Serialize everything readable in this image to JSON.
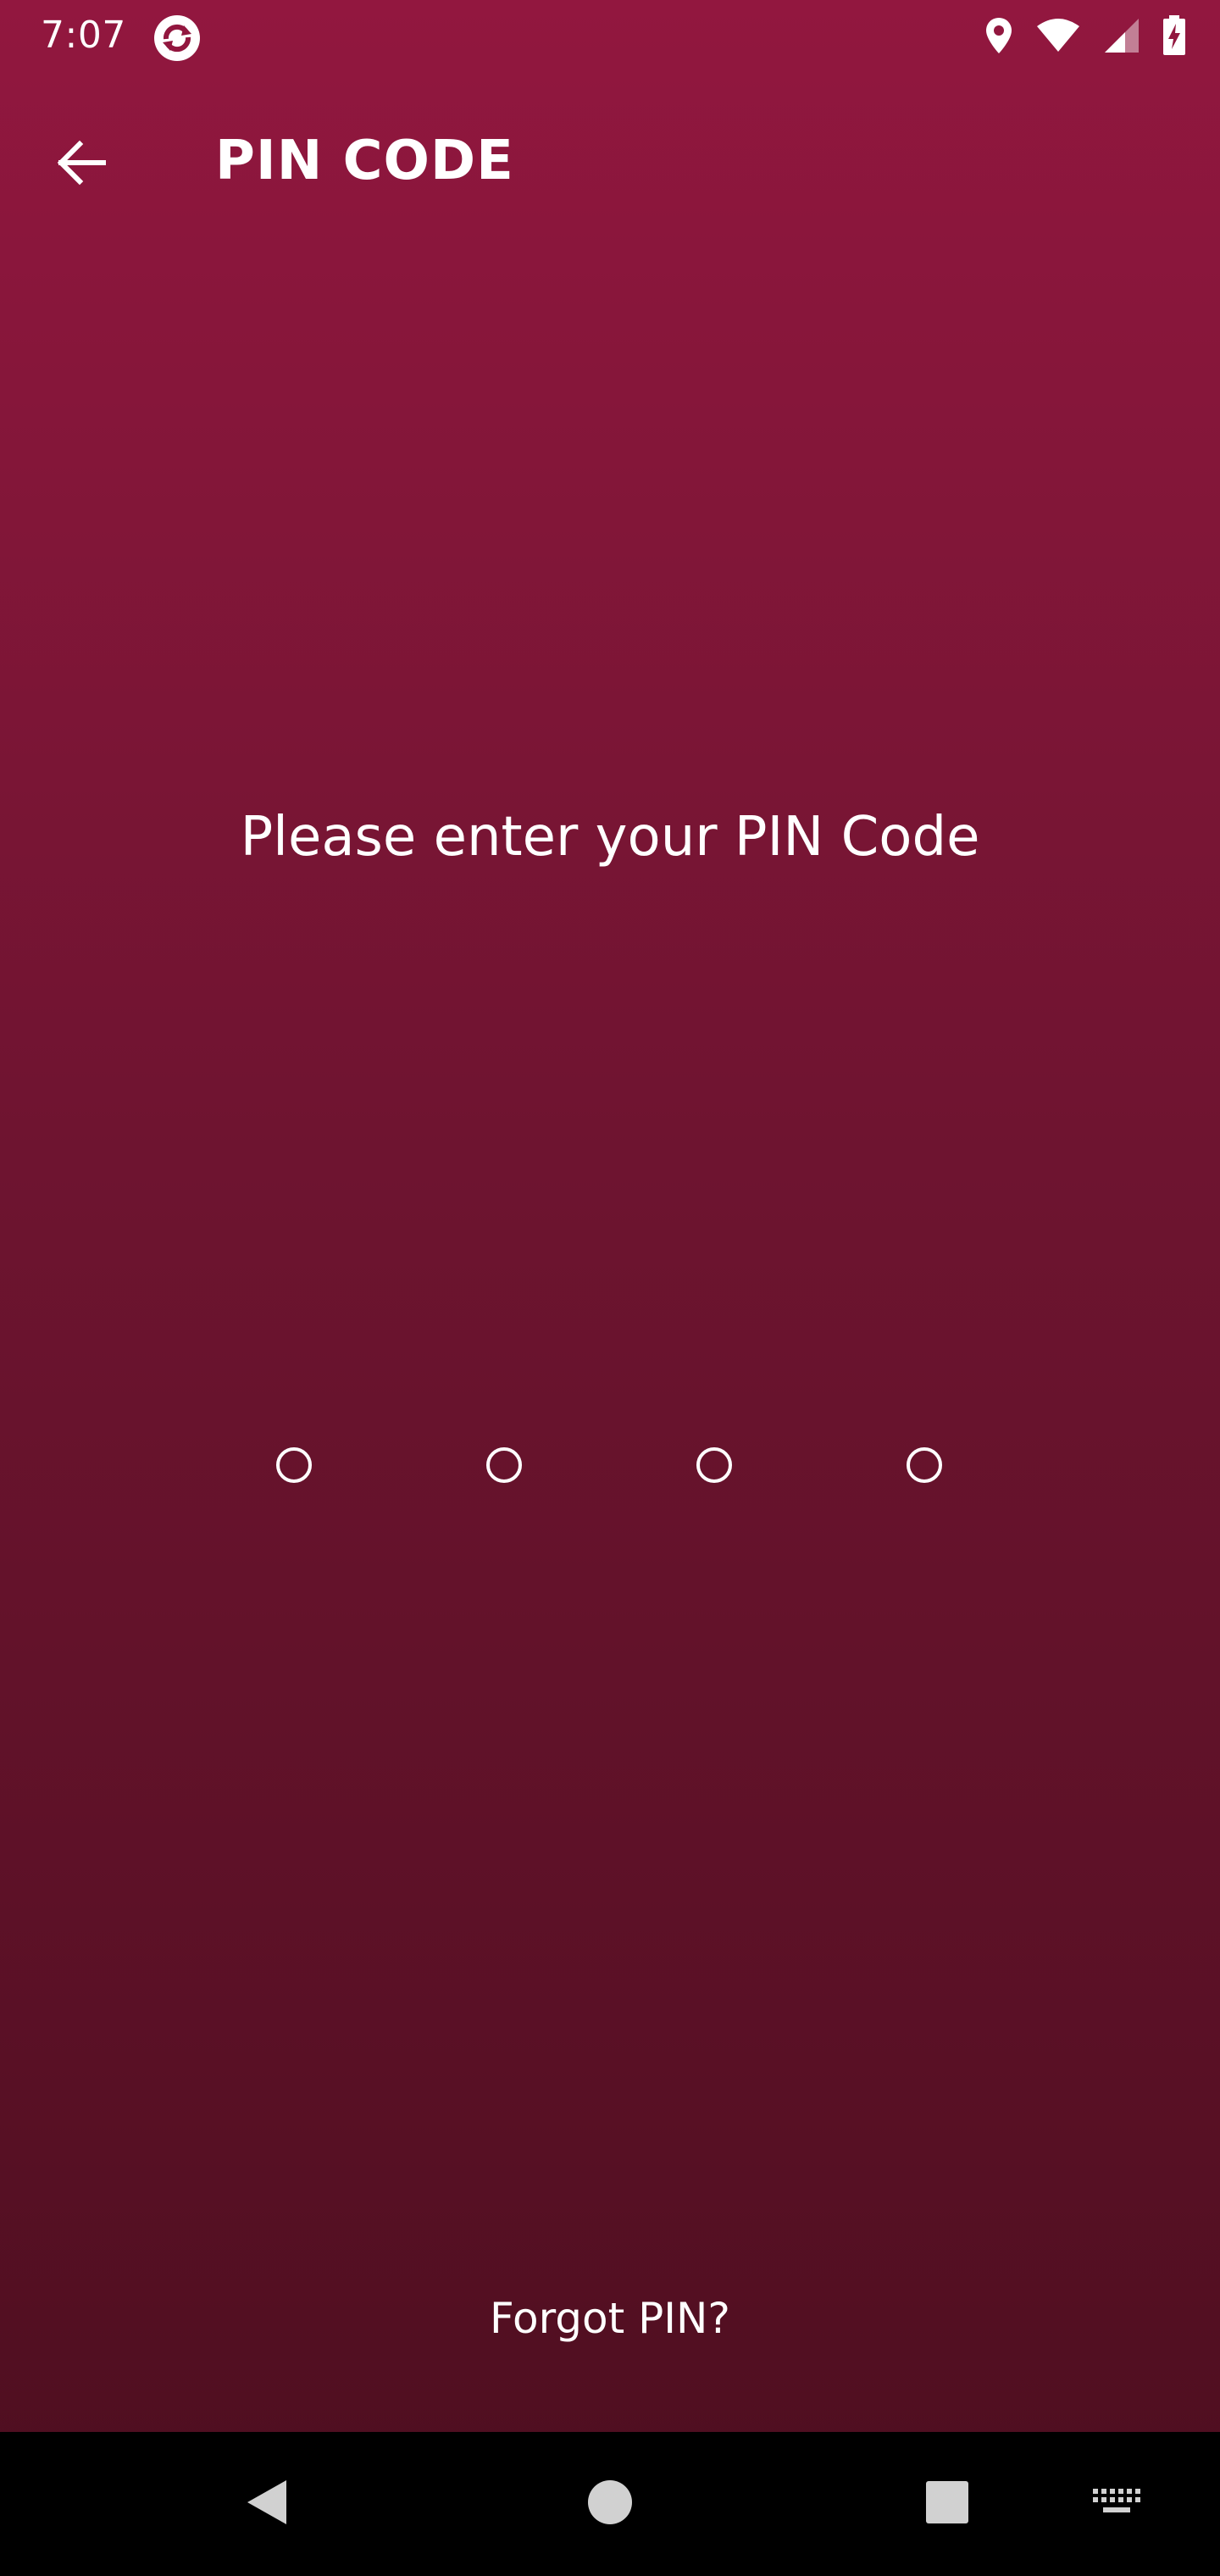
{
  "status_bar": {
    "time": "7:07",
    "icons": [
      "app-sync-icon",
      "location-icon",
      "wifi-icon",
      "signal-icon",
      "battery-charging-icon"
    ]
  },
  "app_bar": {
    "back_icon": "arrow-back-icon",
    "title": "PIN CODE"
  },
  "main": {
    "prompt": "Please enter your PIN Code",
    "pin_length": 4,
    "pin_entered": 0,
    "forgot_label": "Forgot PIN?"
  },
  "nav_bar": {
    "buttons": [
      "back-triangle-icon",
      "home-circle-icon",
      "recents-square-icon",
      "keyboard-icon"
    ]
  },
  "colors": {
    "gradient_top": "#92173f",
    "gradient_bottom": "#4d0e1f",
    "text": "#ffffff",
    "nav_bar": "#000000"
  }
}
